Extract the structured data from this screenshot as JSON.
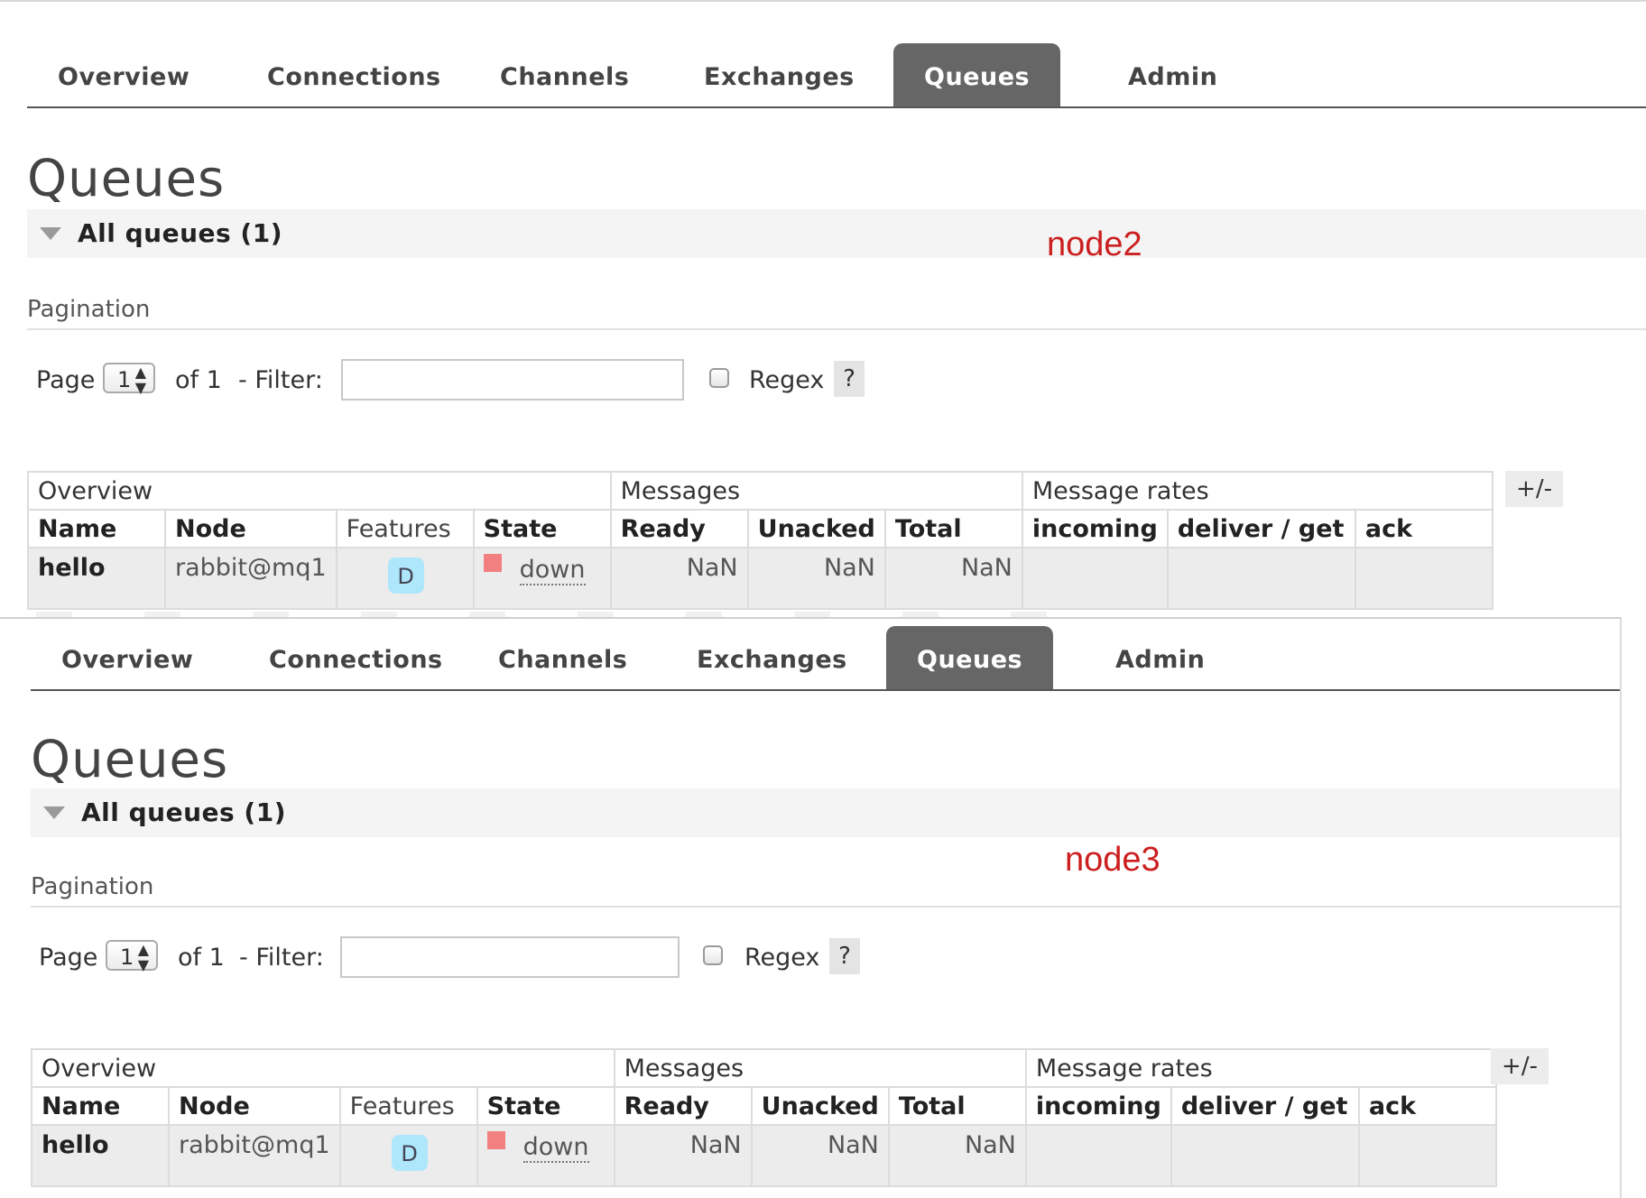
{
  "panels": [
    {
      "nav": [
        "Overview",
        "Connections",
        "Channels",
        "Exchanges",
        "Queues",
        "Admin"
      ],
      "active_nav": "Queues",
      "page_title": "Queues",
      "section_label": "All queues (1)",
      "node_label": "node2",
      "pagination_label": "Pagination",
      "pager": {
        "page_label": "Page",
        "page_value": "1",
        "of_label": "of 1",
        "filter_label": "- Filter:",
        "filter_value": "",
        "regex_label": "Regex",
        "help_label": "?"
      },
      "table": {
        "groups": [
          "Overview",
          "Messages",
          "Message rates"
        ],
        "columns": [
          "Name",
          "Node",
          "Features",
          "State",
          "Ready",
          "Unacked",
          "Total",
          "incoming",
          "deliver / get",
          "ack"
        ],
        "plus_minus": "+/-",
        "rows": [
          {
            "name": "hello",
            "node": "rabbit@mq1",
            "feature": "D",
            "state": "down",
            "ready": "NaN",
            "unacked": "NaN",
            "total": "NaN",
            "incoming": "",
            "deliver_get": "",
            "ack": ""
          }
        ]
      }
    },
    {
      "nav": [
        "Overview",
        "Connections",
        "Channels",
        "Exchanges",
        "Queues",
        "Admin"
      ],
      "active_nav": "Queues",
      "page_title": "Queues",
      "section_label": "All queues (1)",
      "node_label": "node3",
      "pagination_label": "Pagination",
      "pager": {
        "page_label": "Page",
        "page_value": "1",
        "of_label": "of 1",
        "filter_label": "- Filter:",
        "filter_value": "",
        "regex_label": "Regex",
        "help_label": "?"
      },
      "table": {
        "groups": [
          "Overview",
          "Messages",
          "Message rates"
        ],
        "columns": [
          "Name",
          "Node",
          "Features",
          "State",
          "Ready",
          "Unacked",
          "Total",
          "incoming",
          "deliver / get",
          "ack"
        ],
        "plus_minus": "+/-",
        "rows": [
          {
            "name": "hello",
            "node": "rabbit@mq1",
            "feature": "D",
            "state": "down",
            "ready": "NaN",
            "unacked": "NaN",
            "total": "NaN",
            "incoming": "",
            "deliver_get": "",
            "ack": ""
          }
        ]
      }
    }
  ],
  "colors": {
    "active_tab": "#666666",
    "node_label": "#cc1f1f",
    "feature_badge": "#aee6fb",
    "state_down": "#f28080"
  }
}
